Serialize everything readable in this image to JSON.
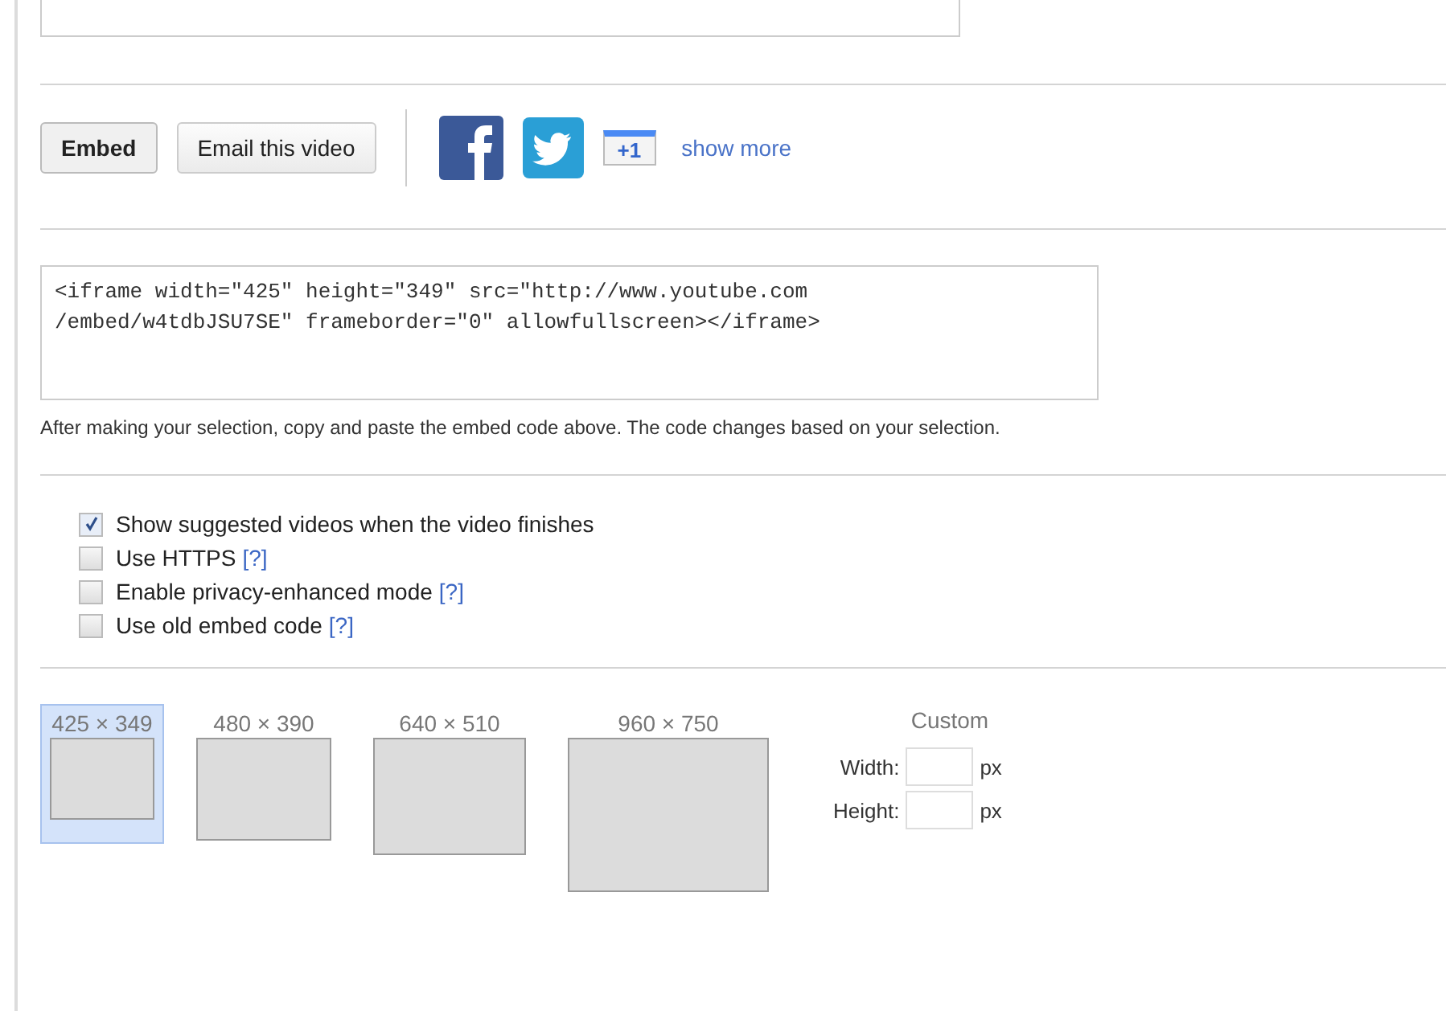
{
  "share_buttons": [
    {
      "label": "Embed",
      "selected": true
    },
    {
      "label": "Email this video",
      "selected": false
    }
  ],
  "social": [
    {
      "kind": "facebook"
    },
    {
      "kind": "twitter"
    },
    {
      "kind": "plusone",
      "label": "+1"
    }
  ],
  "show_more": "show more",
  "embed_code": "<iframe width=\"425\" height=\"349\" src=\"http://www.youtube.com\n/embed/w4tdbJSU7SE\" frameborder=\"0\" allowfullscreen></iframe>",
  "description": "After making your selection, copy and paste the embed code above. The code changes based on your selection.",
  "options": [
    {
      "label": "Show suggested videos when the video finishes",
      "checked": true
    },
    {
      "label": "Use HTTPS",
      "checked": false,
      "help": "[?]"
    },
    {
      "label": "Enable privacy-enhanced mode",
      "checked": false,
      "help": "[?]"
    },
    {
      "label": "Use old embed code",
      "checked": false,
      "help": "[?]"
    }
  ],
  "sizes": [
    {
      "label": "425 × 349",
      "selected": true
    },
    {
      "label": "480 × 390",
      "selected": false
    },
    {
      "label": "640 × 510",
      "selected": false
    },
    {
      "label": "960 × 750",
      "selected": false
    }
  ],
  "custom": {
    "title": "Custom",
    "fields": [
      {
        "label": "Width:",
        "unit": "px"
      },
      {
        "label": "Height:",
        "unit": "px"
      }
    ]
  }
}
